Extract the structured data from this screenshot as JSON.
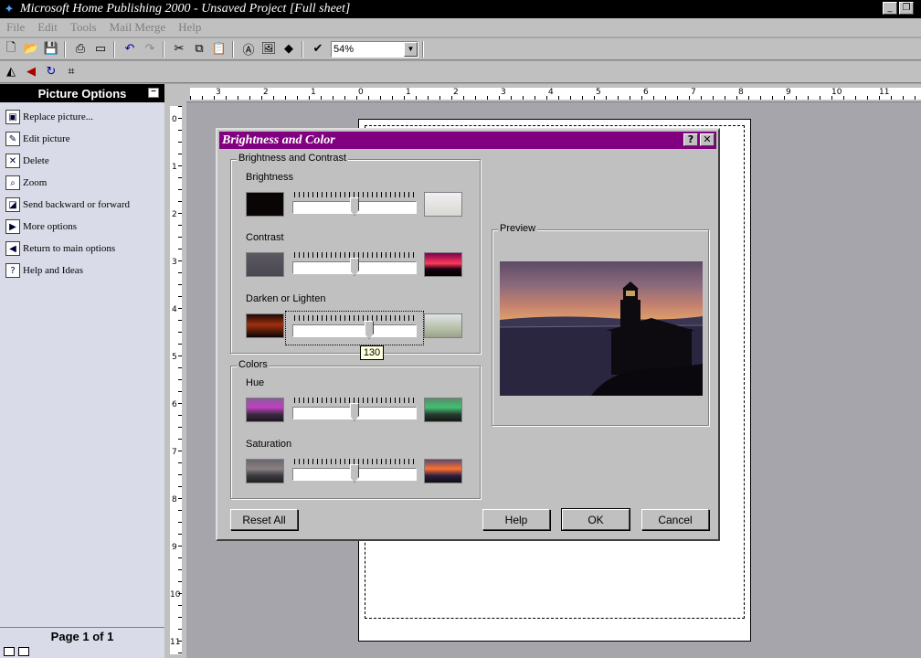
{
  "window": {
    "title": "Microsoft Home Publishing 2000 - Unsaved Project [Full sheet]",
    "min_label": "_",
    "restore_label": "❐"
  },
  "menu": [
    "File",
    "Edit",
    "Tools",
    "Mail Merge",
    "Help"
  ],
  "toolbar": {
    "zoom_value": "54%"
  },
  "left_panel": {
    "title": "Picture Options",
    "items": [
      {
        "label": "Replace picture...",
        "icon": "replace-picture-icon"
      },
      {
        "label": "Edit picture",
        "icon": "pencil-icon"
      },
      {
        "label": "Delete",
        "icon": "delete-x-icon"
      },
      {
        "label": "Zoom",
        "icon": "magnifier-icon"
      },
      {
        "label": "Send backward or forward",
        "icon": "layers-icon"
      },
      {
        "label": "More options",
        "icon": "right-arrow-icon"
      },
      {
        "label": "Return to main options",
        "icon": "left-arrow-icon"
      },
      {
        "label": "Help and Ideas",
        "icon": "help-book-icon"
      }
    ],
    "page_indicator": "Page 1 of 1"
  },
  "ruler": {
    "h_labels": [
      "3",
      "2",
      "1",
      "0",
      "1",
      "2",
      "3",
      "4",
      "5",
      "6",
      "7",
      "8",
      "9",
      "10",
      "11"
    ],
    "v_labels": [
      "0",
      "1",
      "2",
      "3",
      "4",
      "5",
      "6",
      "7",
      "8",
      "9",
      "10",
      "11"
    ]
  },
  "dialog": {
    "title": "Brightness and Color",
    "help_btn": "?",
    "close_btn": "✕",
    "group_brightness_contrast": "Brightness and Contrast",
    "group_colors": "Colors",
    "group_preview": "Preview",
    "sliders": {
      "brightness": {
        "label": "Brightness",
        "position": 0.5
      },
      "contrast": {
        "label": "Contrast",
        "position": 0.5
      },
      "darken_lighten": {
        "label": "Darken or Lighten",
        "position": 0.63,
        "tooltip": "130"
      },
      "hue": {
        "label": "Hue",
        "position": 0.5
      },
      "saturation": {
        "label": "Saturation",
        "position": 0.5
      }
    },
    "buttons": {
      "reset_all": "Reset All",
      "help": "Help",
      "ok": "OK",
      "cancel": "Cancel"
    },
    "colors": {
      "title_bar": "#800080"
    }
  }
}
